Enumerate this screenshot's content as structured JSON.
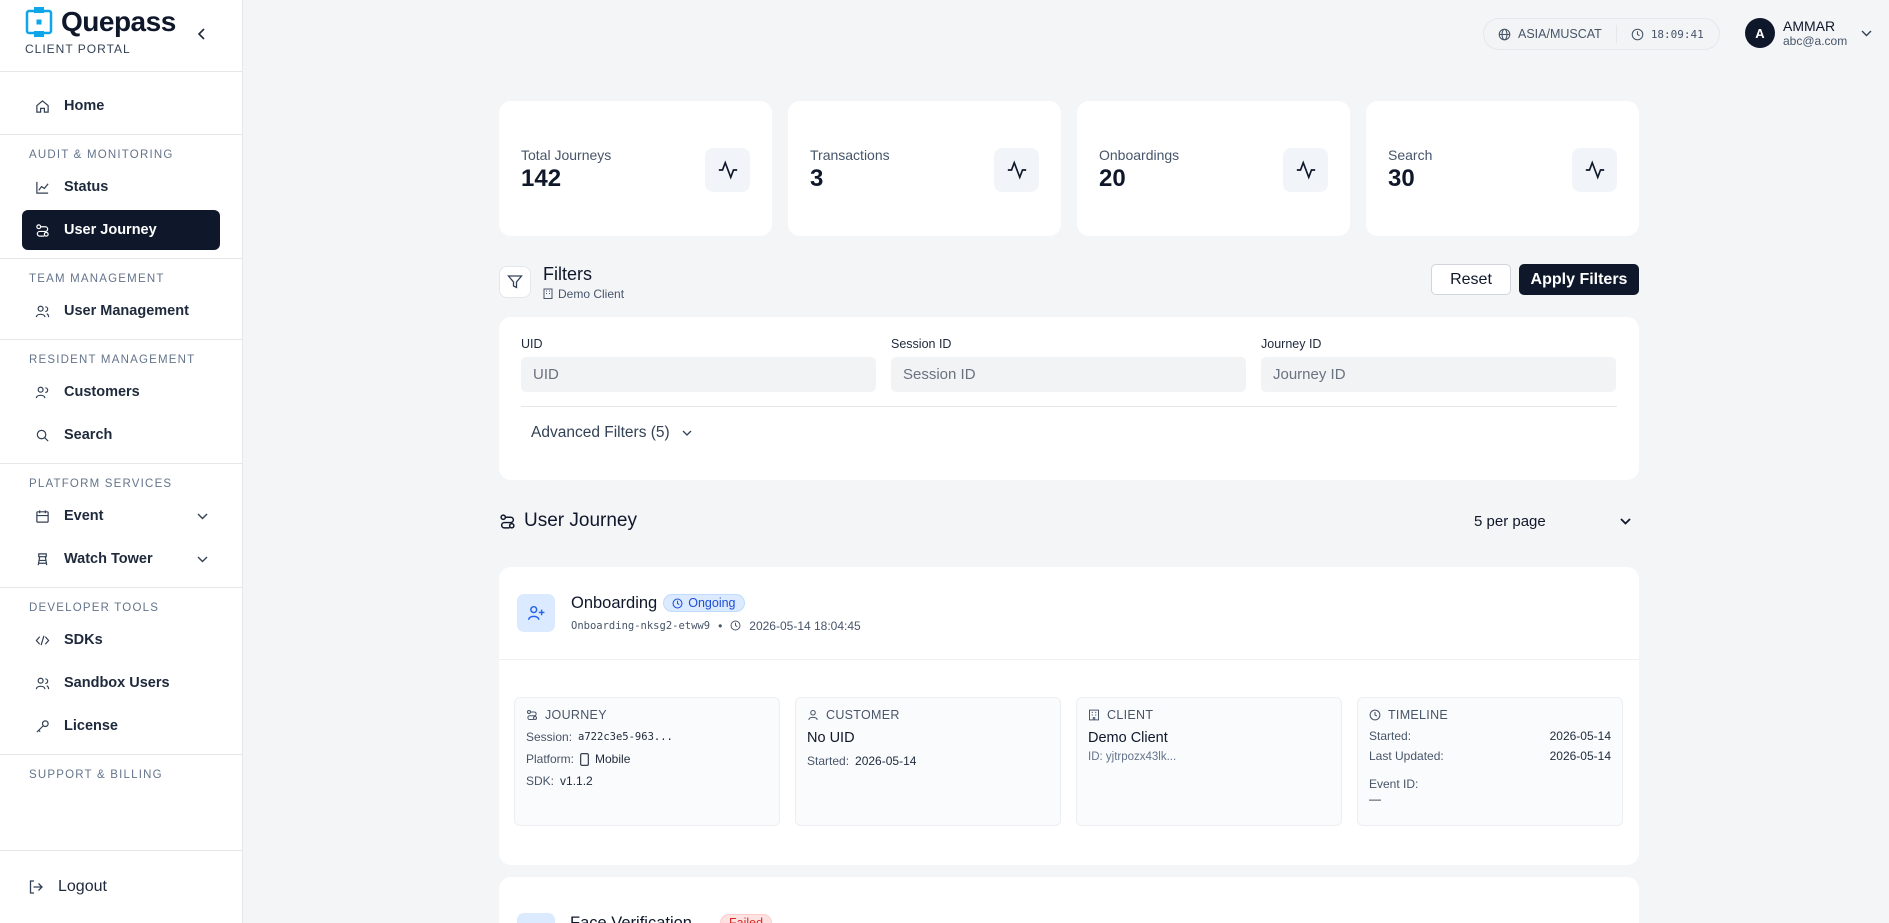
{
  "brand": {
    "name": "Quepass",
    "subtitle": "CLIENT PORTAL"
  },
  "sidebar": {
    "home": "Home",
    "sections": {
      "audit": {
        "title": "AUDIT & MONITORING",
        "status": "Status",
        "user_journey": "User Journey"
      },
      "team": {
        "title": "TEAM MANAGEMENT",
        "user_management": "User Management"
      },
      "resident": {
        "title": "RESIDENT MANAGEMENT",
        "customers": "Customers",
        "search": "Search"
      },
      "platform": {
        "title": "PLATFORM SERVICES",
        "event": "Event",
        "watch_tower": "Watch Tower"
      },
      "developer": {
        "title": "DEVELOPER TOOLS",
        "sdks": "SDKs",
        "sandbox_users": "Sandbox Users",
        "license": "License"
      },
      "support": {
        "title": "SUPPORT & BILLING"
      }
    },
    "logout": "Logout"
  },
  "topbar": {
    "timezone": "ASIA/MUSCAT",
    "time": "18:09:41",
    "user_initial": "A",
    "user_name": "AMMAR",
    "user_email": "abc@a.com"
  },
  "stats": [
    {
      "label": "Total Journeys",
      "value": "142"
    },
    {
      "label": "Transactions",
      "value": "3"
    },
    {
      "label": "Onboardings",
      "value": "20"
    },
    {
      "label": "Search",
      "value": "30"
    }
  ],
  "filters": {
    "title": "Filters",
    "client": "Demo Client",
    "reset": "Reset",
    "apply": "Apply Filters",
    "uid_label": "UID",
    "uid_placeholder": "UID",
    "session_label": "Session ID",
    "session_placeholder": "Session ID",
    "journey_label": "Journey ID",
    "journey_placeholder": "Journey ID",
    "advanced": "Advanced Filters (5)"
  },
  "journey_list": {
    "title": "User Journey",
    "per_page": "5 per page"
  },
  "journey_card": {
    "title": "Onboarding",
    "status": "Ongoing",
    "journey_code": "Onboarding-nksg2-etww9",
    "timestamp": "2026-05-14 18:04:45",
    "journey": {
      "heading": "JOURNEY",
      "session_label": "Session:",
      "session_value": "a722c3e5-963...",
      "platform_label": "Platform:",
      "platform_value": "Mobile",
      "sdk_label": "SDK:",
      "sdk_value": "v1.1.2"
    },
    "customer": {
      "heading": "CUSTOMER",
      "uid": "No UID",
      "started_label": "Started:",
      "started_value": "2026-05-14"
    },
    "client": {
      "heading": "CLIENT",
      "name": "Demo Client",
      "id": "ID: yjtrpozx43lk..."
    },
    "timeline": {
      "heading": "TIMELINE",
      "started_label": "Started:",
      "started_value": "2026-05-14",
      "updated_label": "Last Updated:",
      "updated_value": "2026-05-14",
      "event_label": "Event ID:",
      "event_value": "—"
    }
  },
  "next_card": {
    "title": "Face Verification",
    "status": "Failed"
  }
}
